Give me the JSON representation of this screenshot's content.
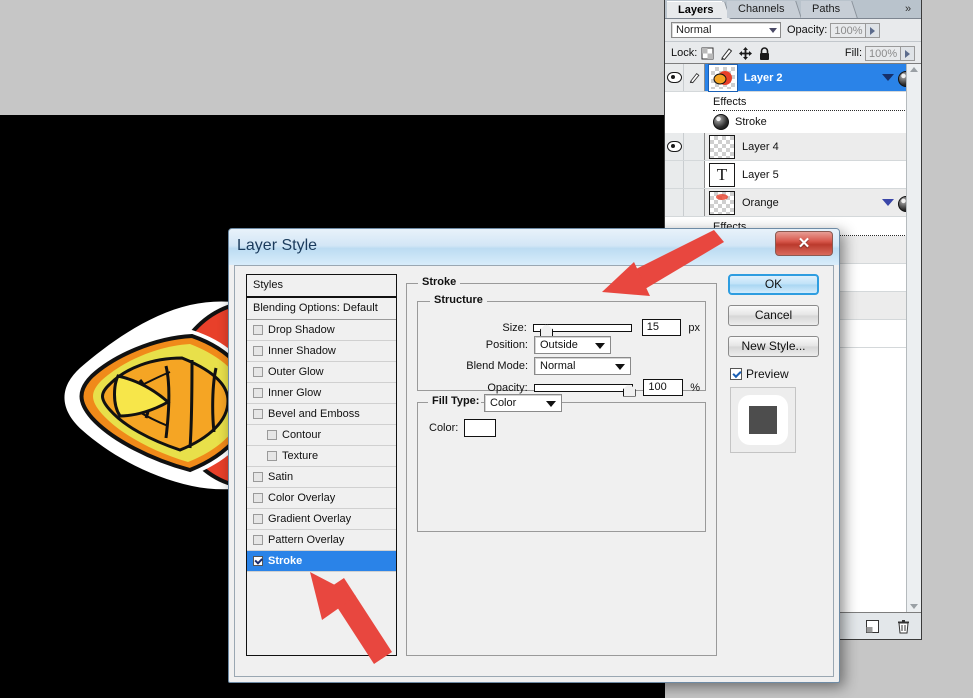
{
  "layers_panel": {
    "tabs": [
      {
        "label": "Layers",
        "active": true
      },
      {
        "label": "Channels",
        "active": false
      },
      {
        "label": "Paths",
        "active": false
      }
    ],
    "menu_icon": "»",
    "blend_mode": "Normal",
    "opacity_label": "Opacity:",
    "opacity_value": "100%",
    "lock_label": "Lock:",
    "lock_icons": [
      "transparency-lock-icon",
      "pixels-lock-icon",
      "position-lock-icon",
      "all-lock-icon"
    ],
    "fill_label": "Fill:",
    "fill_value": "100%",
    "rows": [
      {
        "name": "Layer 2",
        "selected": true,
        "visible": true,
        "linked": true,
        "has_fx": true,
        "thumb": "orange-art"
      },
      {
        "name": "Effects",
        "type": "effects-header",
        "visible": true
      },
      {
        "name": "Stroke",
        "type": "effect-item",
        "visible": true
      },
      {
        "name": "Layer 4",
        "selected": false,
        "visible": true,
        "linked": false,
        "has_fx": false,
        "thumb": "empty"
      },
      {
        "name": "Layer 5",
        "selected": false,
        "visible": false,
        "linked": false,
        "has_fx": false,
        "thumb": "text"
      },
      {
        "name": "Orange",
        "selected": false,
        "visible": false,
        "linked": false,
        "has_fx": true,
        "thumb": "orange-art"
      },
      {
        "name": "Effects",
        "type": "effects-header",
        "visible": true
      }
    ],
    "footer_icons": [
      "new-layer-icon",
      "delete-layer-icon"
    ]
  },
  "dialog": {
    "title": "Layer Style",
    "close_label": "✕",
    "styles": {
      "header": "Styles",
      "blending_options": "Blending Options: Default",
      "items": [
        {
          "label": "Drop Shadow",
          "checked": false,
          "indent": false,
          "selected": false
        },
        {
          "label": "Inner Shadow",
          "checked": false,
          "indent": false,
          "selected": false
        },
        {
          "label": "Outer Glow",
          "checked": false,
          "indent": false,
          "selected": false
        },
        {
          "label": "Inner Glow",
          "checked": false,
          "indent": false,
          "selected": false
        },
        {
          "label": "Bevel and Emboss",
          "checked": false,
          "indent": false,
          "selected": false
        },
        {
          "label": "Contour",
          "checked": false,
          "indent": true,
          "selected": false
        },
        {
          "label": "Texture",
          "checked": false,
          "indent": true,
          "selected": false
        },
        {
          "label": "Satin",
          "checked": false,
          "indent": false,
          "selected": false
        },
        {
          "label": "Color Overlay",
          "checked": false,
          "indent": false,
          "selected": false
        },
        {
          "label": "Gradient Overlay",
          "checked": false,
          "indent": false,
          "selected": false
        },
        {
          "label": "Pattern Overlay",
          "checked": false,
          "indent": false,
          "selected": false
        },
        {
          "label": "Stroke",
          "checked": true,
          "indent": false,
          "selected": true
        }
      ]
    },
    "stroke": {
      "group_title": "Stroke",
      "structure_title": "Structure",
      "size_label": "Size:",
      "size_value": "15",
      "size_unit": "px",
      "size_percent": 7,
      "position_label": "Position:",
      "position_value": "Outside",
      "blend_mode_label": "Blend Mode:",
      "blend_mode_value": "Normal",
      "opacity_label": "Opacity:",
      "opacity_value": "100",
      "opacity_unit": "%",
      "opacity_percent": 100,
      "fill_type_label": "Fill Type:",
      "fill_type_value": "Color",
      "color_label": "Color:",
      "color_value": "#ffffff"
    },
    "buttons": {
      "ok": "OK",
      "cancel": "Cancel",
      "new_style": "New Style...",
      "preview": "Preview"
    }
  },
  "colors": {
    "accent_blue": "#2a83e8",
    "arrow_red": "#e8473f",
    "canvas_black": "#000000",
    "desktop_gray": "#c6c6c6"
  }
}
